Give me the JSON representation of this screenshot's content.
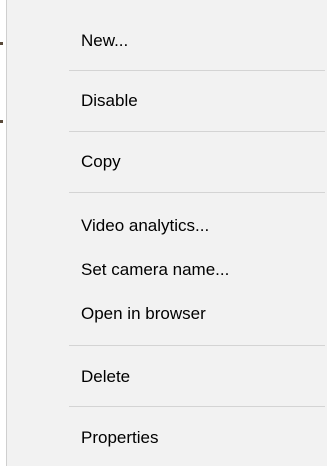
{
  "menu": {
    "items": [
      {
        "label": "New..."
      },
      {
        "label": "Disable"
      },
      {
        "label": "Copy"
      },
      {
        "label": "Video analytics..."
      },
      {
        "label": "Set camera name..."
      },
      {
        "label": "Open in browser"
      },
      {
        "label": "Delete"
      },
      {
        "label": "Properties"
      }
    ]
  },
  "colors": {
    "menu_background": "#f2f2f2",
    "separator": "#d4d4d4",
    "text": "#000000"
  }
}
